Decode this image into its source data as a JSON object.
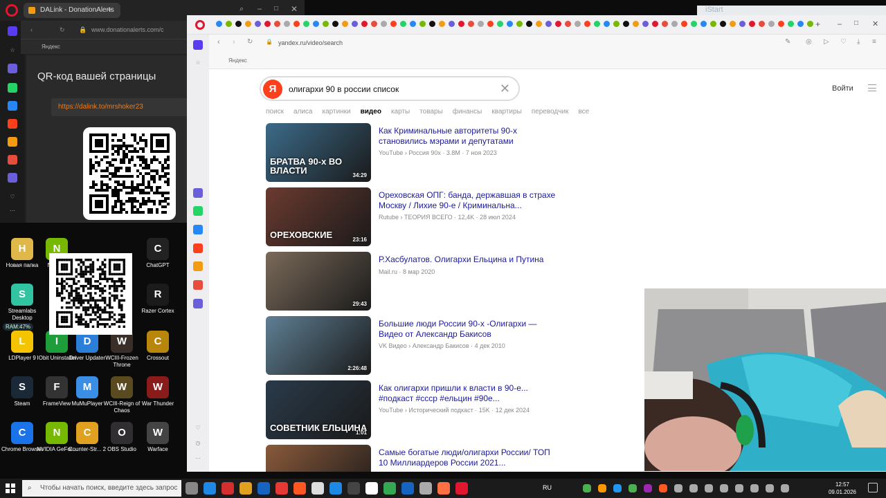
{
  "left_browser": {
    "tab_title": "DALink - DonationAlerts",
    "url": "www.donationalerts.com/c",
    "bookmark": "Яндекс",
    "qr_title": "QR-код вашей страницы",
    "qr_link": "https://dalink.to/mrshoker23"
  },
  "desktop": {
    "icons": [
      {
        "label": "Новая папка",
        "icon": "folder-icon",
        "color": "#e0b84a"
      },
      {
        "label": "NVIDIA",
        "icon": "nvidia-icon",
        "color": "#76b900"
      },
      {
        "label": "ChatGPT",
        "icon": "chatgpt-icon",
        "color": "#222"
      },
      {
        "label": "Streamlabs Desktop",
        "icon": "streamlabs-icon",
        "color": "#31c3a2"
      },
      {
        "label": "Razer Cortex",
        "icon": "razer-icon",
        "color": "#1b1b1b"
      },
      {
        "label": "LDPlayer 9",
        "icon": "ldplayer-icon",
        "color": "#f5c400"
      },
      {
        "label": "IObit Uninstaller",
        "icon": "iobit-icon",
        "color": "#1e9e3a"
      },
      {
        "label": "Driver Updater",
        "icon": "driver-updater-icon",
        "color": "#2b7fd9"
      },
      {
        "label": "WCIII-Frozen Throne",
        "icon": "wc3-icon",
        "color": "#3a2f28"
      },
      {
        "label": "Crossout",
        "icon": "crossout-icon",
        "color": "#b8860b"
      },
      {
        "label": "Steam",
        "icon": "steam-icon",
        "color": "#1b2838"
      },
      {
        "label": "FrameView",
        "icon": "frameview-icon",
        "color": "#333"
      },
      {
        "label": "MuMuPlayer",
        "icon": "mumu-icon",
        "color": "#3a8ee6"
      },
      {
        "label": "WCIII-Reign of Chaos",
        "icon": "wc3-roc-icon",
        "color": "#5a4a20"
      },
      {
        "label": "War Thunder",
        "icon": "warthunder-icon",
        "color": "#8a1b1b"
      },
      {
        "label": "Chrome Browser",
        "icon": "chrome-icon",
        "color": "#1a73e8"
      },
      {
        "label": "NVIDIA GeFor...",
        "icon": "geforce-icon",
        "color": "#76b900"
      },
      {
        "label": "Counter-Str... 2",
        "icon": "cs2-icon",
        "color": "#e0a020"
      },
      {
        "label": "OBS Studio",
        "icon": "obs-icon",
        "color": "#302e31"
      },
      {
        "label": "Warface",
        "icon": "warface-icon",
        "color": "#444"
      }
    ],
    "ram": "RAM:47%"
  },
  "right_browser": {
    "url": "yandex.ru/video/search",
    "bookmark": "Яндекс",
    "search_query": "олигархи 90 в россии список",
    "login": "Войти",
    "nav": [
      "поиск",
      "алиса",
      "картинки",
      "видео",
      "карты",
      "товары",
      "финансы",
      "квартиры",
      "переводчик",
      "все"
    ],
    "active_nav": "видео",
    "results": [
      {
        "title": "Как Криминальные авторитеты 90-х становились мэрами и депутатами",
        "meta": "YouTube › Россия 90х  ·  3.8M  ·  7 ноя 2023",
        "duration": "34:29",
        "caption": "БРАТВА 90-х ВО ВЛАСТИ",
        "thumb_color": "#3c6b8a"
      },
      {
        "title": "Ореховская ОПГ: банда, державшая в страхе Москву / Лихие 90-е / Криминальна...",
        "meta": "Rutube › ТЕОРИЯ ВСЕГО  ·  12,4K  ·  28 июл 2024",
        "duration": "23:16",
        "caption": "ОРЕХОВСКИЕ",
        "thumb_color": "#6b3a30"
      },
      {
        "title": "Р.Хасбулатов. Олигархи Ельцина и Путина",
        "meta": "Mail.ru  ·  8 мар 2020",
        "duration": "29:43",
        "caption": "",
        "thumb_color": "#7a6a5a"
      },
      {
        "title": "Большие люди России 90-х -Олигархи — Видео от Александр Бакисов",
        "meta": "VK Видео › Александр Бакисов  ·  4 дек 2010",
        "duration": "2:26:48",
        "caption": "",
        "thumb_color": "#5f7f94"
      },
      {
        "title": "Как олигархи пришли к власти в 90-е... #подкаст #ссср #ельцин #90е...",
        "meta": "YouTube › Исторический подкаст  ·  15K  ·  12 дек 2024",
        "duration": "1:01",
        "caption": "СОВЕТНИК ЕЛЬЦИНА",
        "thumb_color": "#2a3a4a"
      },
      {
        "title": "Самые богатые люди/олигархи России/ ТОП 10 Миллиардеров России 2021...",
        "meta": "",
        "duration": "",
        "caption": "",
        "thumb_color": "#8a5a3a"
      }
    ]
  },
  "istart": "iStart",
  "taskbar": {
    "search_placeholder": "Чтобы начать поиск, введите здесь запрос",
    "lang": "RU",
    "time": "12:57",
    "date": "09.01.2026"
  }
}
